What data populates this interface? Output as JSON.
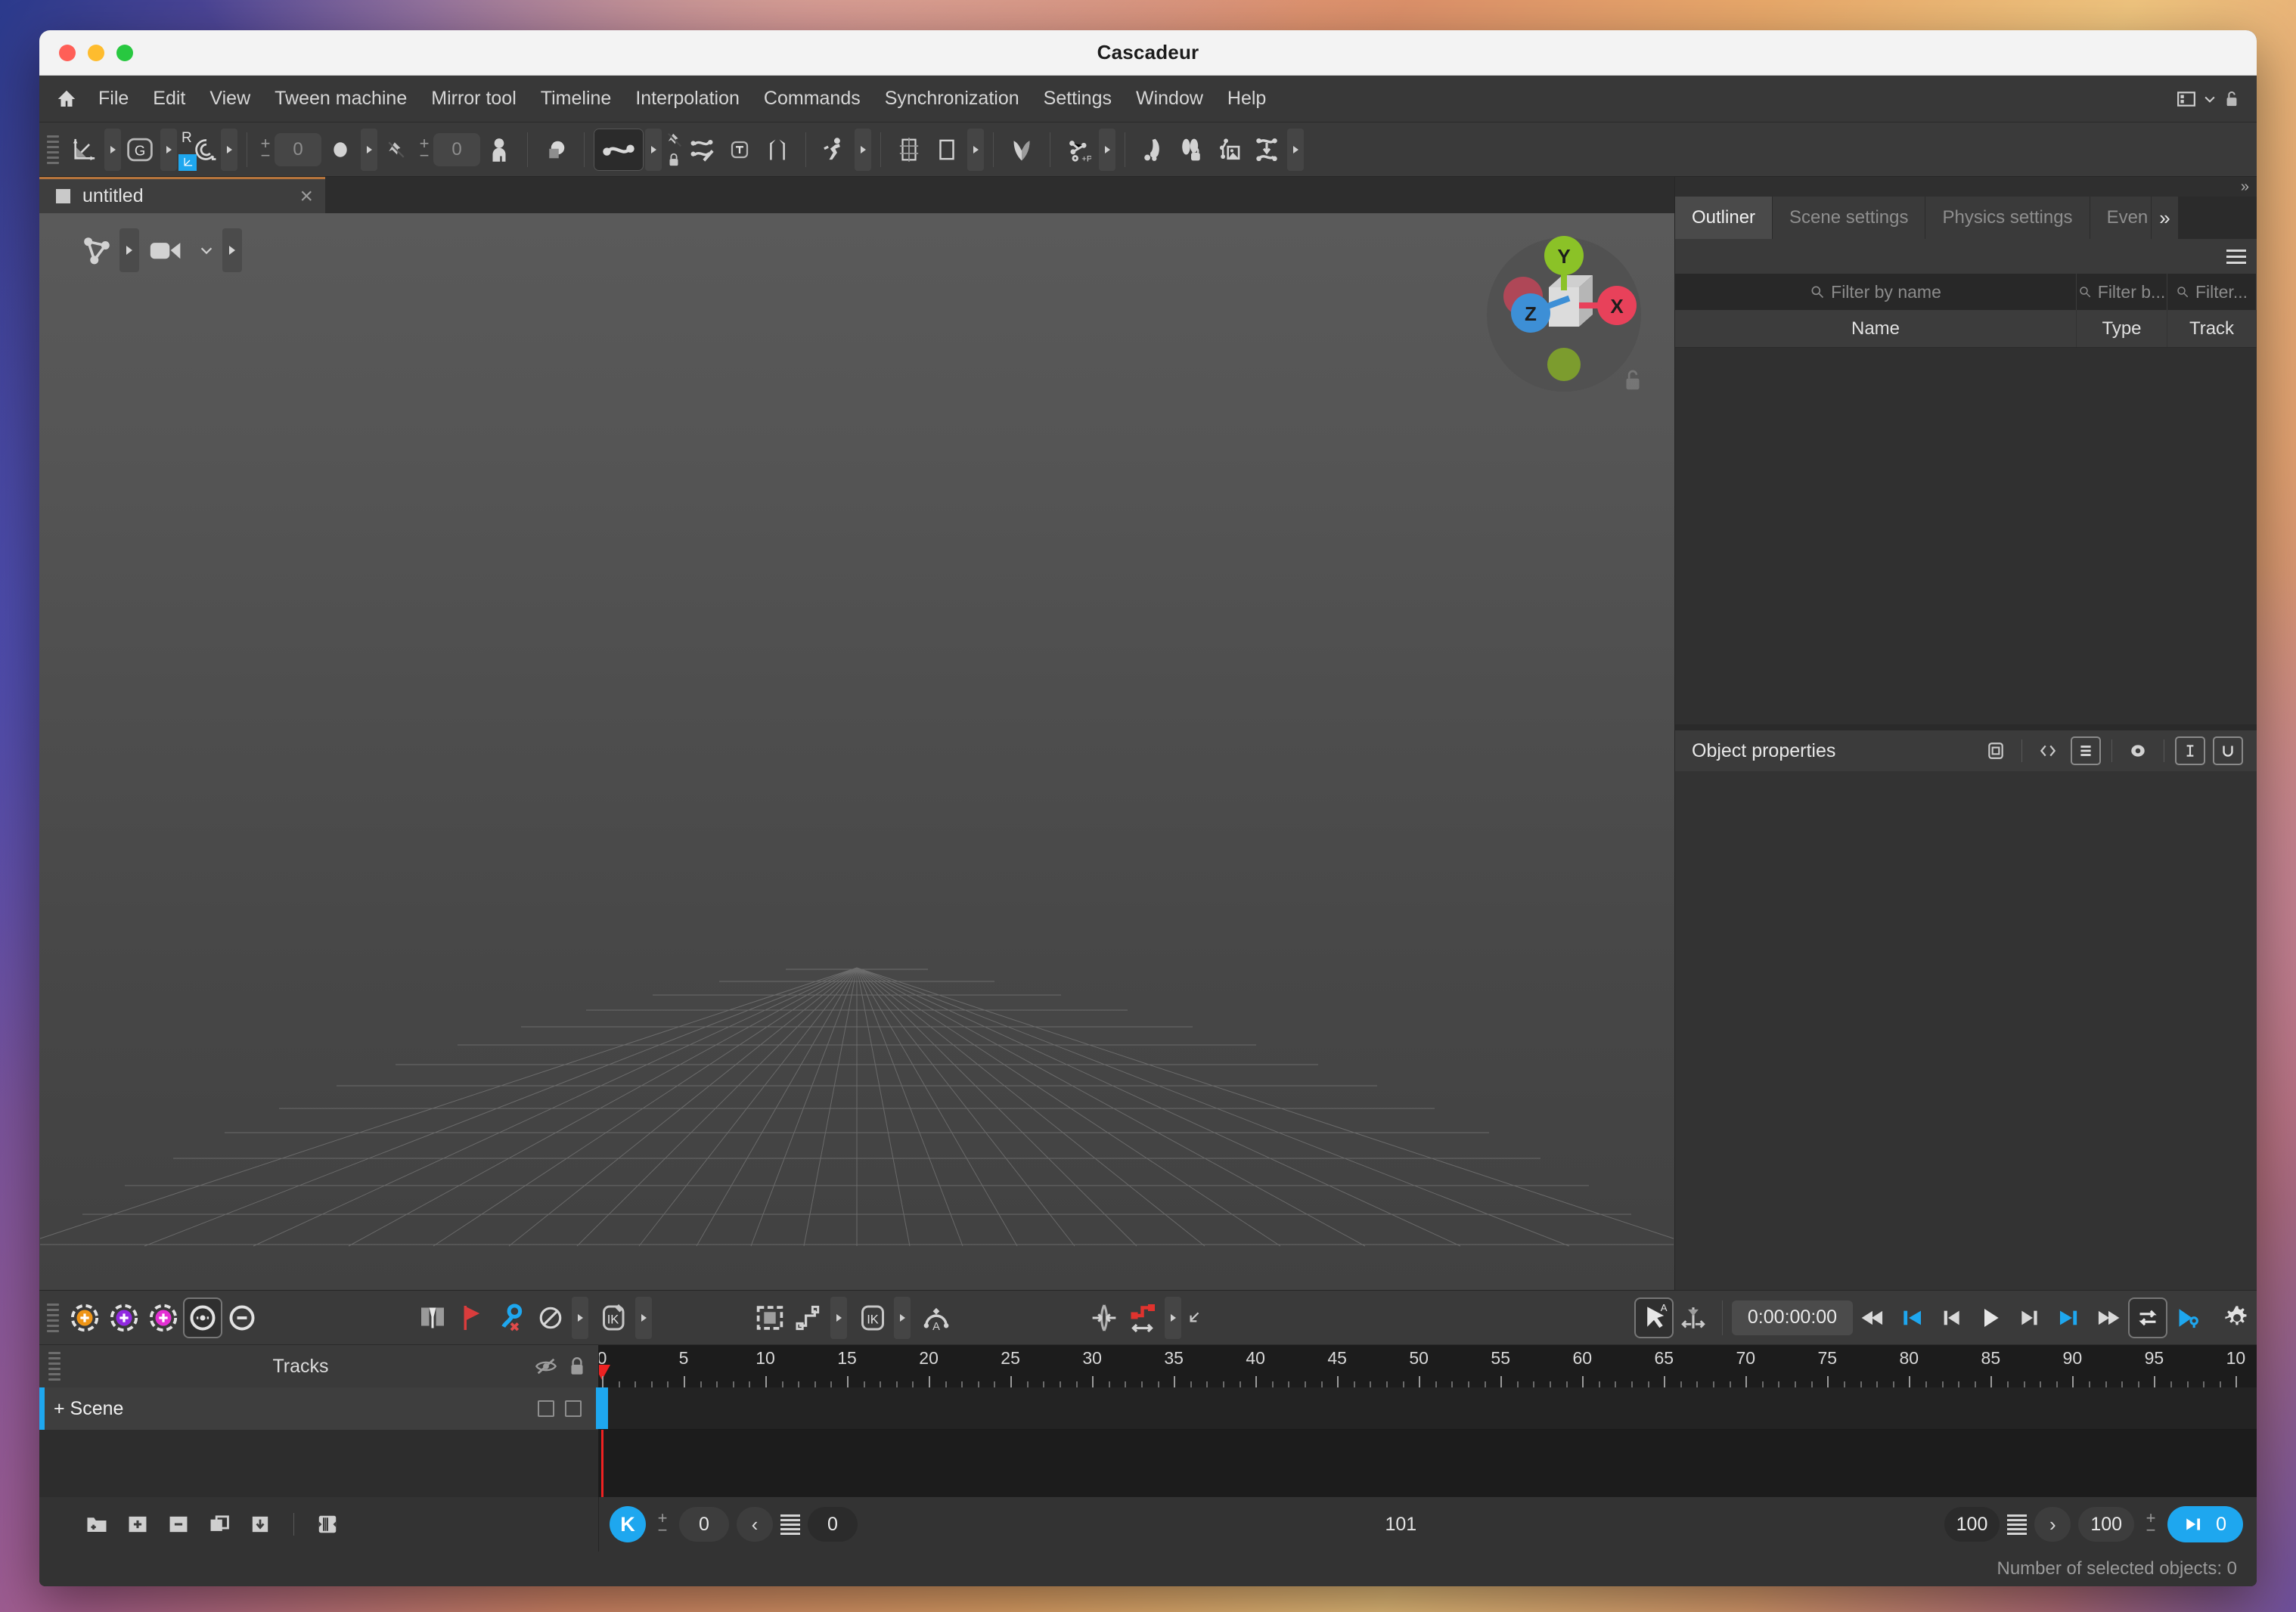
{
  "window": {
    "title": "Cascadeur"
  },
  "menubar": {
    "home_icon": "home-icon",
    "items": [
      "File",
      "Edit",
      "View",
      "Tween machine",
      "Mirror tool",
      "Timeline",
      "Interpolation",
      "Commands",
      "Synchronization",
      "Settings",
      "Window",
      "Help"
    ],
    "right_icons": [
      "layout-preset-icon",
      "chevron-down-icon",
      "lock-open-icon"
    ]
  },
  "main_toolbar": {
    "groups": [
      {
        "buttons": [
          {
            "name": "axis-transform-icon",
            "arrow": true,
            "active": false
          },
          {
            "name": "global-space-icon",
            "arrow": true,
            "active": false,
            "label": "G"
          },
          {
            "name": "rotation-mode-icon",
            "arrow": true,
            "active": false,
            "badge": "R",
            "sub": "axis-small-icon"
          }
        ]
      },
      {
        "buttons": [
          {
            "name": "point-size-stepper",
            "value": "0"
          },
          {
            "name": "point-display-icon",
            "arrow": true
          },
          {
            "name": "pin-off-icon"
          },
          {
            "name": "joint-size-stepper",
            "value": "0"
          },
          {
            "name": "character-icon"
          }
        ]
      },
      {
        "buttons": [
          {
            "name": "shape-overlap-icon"
          }
        ]
      },
      {
        "buttons": [
          {
            "name": "spline-curve-icon",
            "arrow": true,
            "active": true
          },
          {
            "name": "pin-lock-icon"
          },
          {
            "name": "trajectory-edit-icon"
          },
          {
            "name": "text-tool-icon"
          },
          {
            "name": "brackets-icon"
          }
        ]
      },
      {
        "buttons": [
          {
            "name": "running-character-icon",
            "arrow": true
          }
        ]
      },
      {
        "buttons": [
          {
            "name": "grid-frame-icon"
          },
          {
            "name": "rectangle-icon",
            "arrow": true
          }
        ]
      },
      {
        "buttons": [
          {
            "name": "heart-shape-icon"
          }
        ]
      },
      {
        "buttons": [
          {
            "name": "physics-plus-p-icon",
            "arrow": true
          }
        ]
      },
      {
        "buttons": [
          {
            "name": "foot-roll-icon"
          },
          {
            "name": "footprints-lock-icon"
          },
          {
            "name": "pose-image-icon"
          },
          {
            "name": "drop-to-floor-icon",
            "arrow": true
          }
        ]
      }
    ]
  },
  "document_tabs": [
    {
      "label": "untitled",
      "close": "×",
      "active": true
    }
  ],
  "viewport": {
    "toolbar": [
      {
        "name": "selection-filter-icon",
        "arrow": true
      },
      {
        "name": "camera-icon",
        "chevron": true,
        "arrow": true
      }
    ],
    "gizmo": {
      "axes": [
        "Y",
        "X",
        "Z"
      ],
      "lock_icon": "lock-open-icon",
      "colors": {
        "x": "#e8415a",
        "y": "#8bc227",
        "z": "#3d8fd6"
      }
    }
  },
  "right_dock": {
    "expand_icon": "»",
    "tabs": [
      {
        "label": "Outliner",
        "active": true
      },
      {
        "label": "Scene settings",
        "active": false
      },
      {
        "label": "Physics settings",
        "active": false
      },
      {
        "label": "Even",
        "active": false
      }
    ],
    "tabs_more": "»",
    "menu_icon": "hamburger-icon",
    "filters": [
      {
        "placeholder": "Filter by name",
        "icon": "search-icon"
      },
      {
        "placeholder": "Filter b...",
        "icon": "search-icon"
      },
      {
        "placeholder": "Filter...",
        "icon": "search-icon"
      }
    ],
    "columns": [
      "Name",
      "Type",
      "Track"
    ],
    "rows": []
  },
  "object_properties": {
    "title": "Object properties",
    "icons": [
      "frame-icon",
      "code-brackets-icon",
      "list-lines-icon",
      "visibility-dot-icon",
      "text-cursor-icon",
      "union-icon"
    ]
  },
  "timeline_toolbar": {
    "left_icons": [
      "add-keyframe-orange-icon",
      "add-keyframe-purple-icon",
      "add-keyframe-magenta-icon",
      "interpolate-keys-icon",
      "remove-keyframe-icon"
    ],
    "mid_icons": [
      "key-marker-icon",
      "red-flag-icon",
      "delete-key-icon",
      "forbidden-icon",
      "ik-pencil-icon"
    ],
    "mid2_icons": [
      "select-box-icon",
      "step-graph-icon",
      "ik-icon",
      "auto-arc-icon"
    ],
    "right_icons": [
      "mirror-arrows-icon",
      "step-path-red-icon",
      "corner-arrow-icon"
    ],
    "extra_icons": [
      "auto-physics-icon",
      "center-pivot-icon"
    ],
    "timecode": "0:00:00:00",
    "transport": [
      "rewind-icon",
      "skip-start-icon",
      "prev-frame-icon",
      "play-icon",
      "next-frame-icon",
      "skip-end-icon",
      "fast-forward-icon",
      "loop-icon",
      "play-key-icon"
    ],
    "settings_icon": "gear-icon"
  },
  "tracks_panel": {
    "header_title": "Tracks",
    "header_icons": [
      "eye-off-icon",
      "lock-icon"
    ],
    "items": [
      {
        "label": "+ Scene",
        "checkboxes": 2
      }
    ]
  },
  "ruler": {
    "labels": [
      "0",
      "5",
      "10",
      "15",
      "20",
      "25",
      "30",
      "35",
      "40",
      "45",
      "50",
      "55",
      "60",
      "65",
      "70",
      "75",
      "80",
      "85",
      "90",
      "95",
      "10"
    ],
    "start": 0,
    "end": 100,
    "step": 5,
    "playhead_frame": 0
  },
  "bottom_bar": {
    "left_icons": [
      "new-folder-icon",
      "add-track-icon",
      "remove-track-icon",
      "duplicate-track-icon",
      "collapse-track-icon",
      "split-track-icon"
    ],
    "key_button": "K",
    "range_start_stepper": "0",
    "prev_chevron": "‹",
    "list_icon": "list-lines-icon",
    "range_start_value": "0",
    "frame_count": "101",
    "range_end_value": "100",
    "next_chevron": "›",
    "range_end_stepper": "100",
    "end_frame_button": {
      "icon": "go-to-end-icon",
      "value": "0"
    }
  },
  "status_bar": {
    "text": "Number of selected objects: 0"
  }
}
